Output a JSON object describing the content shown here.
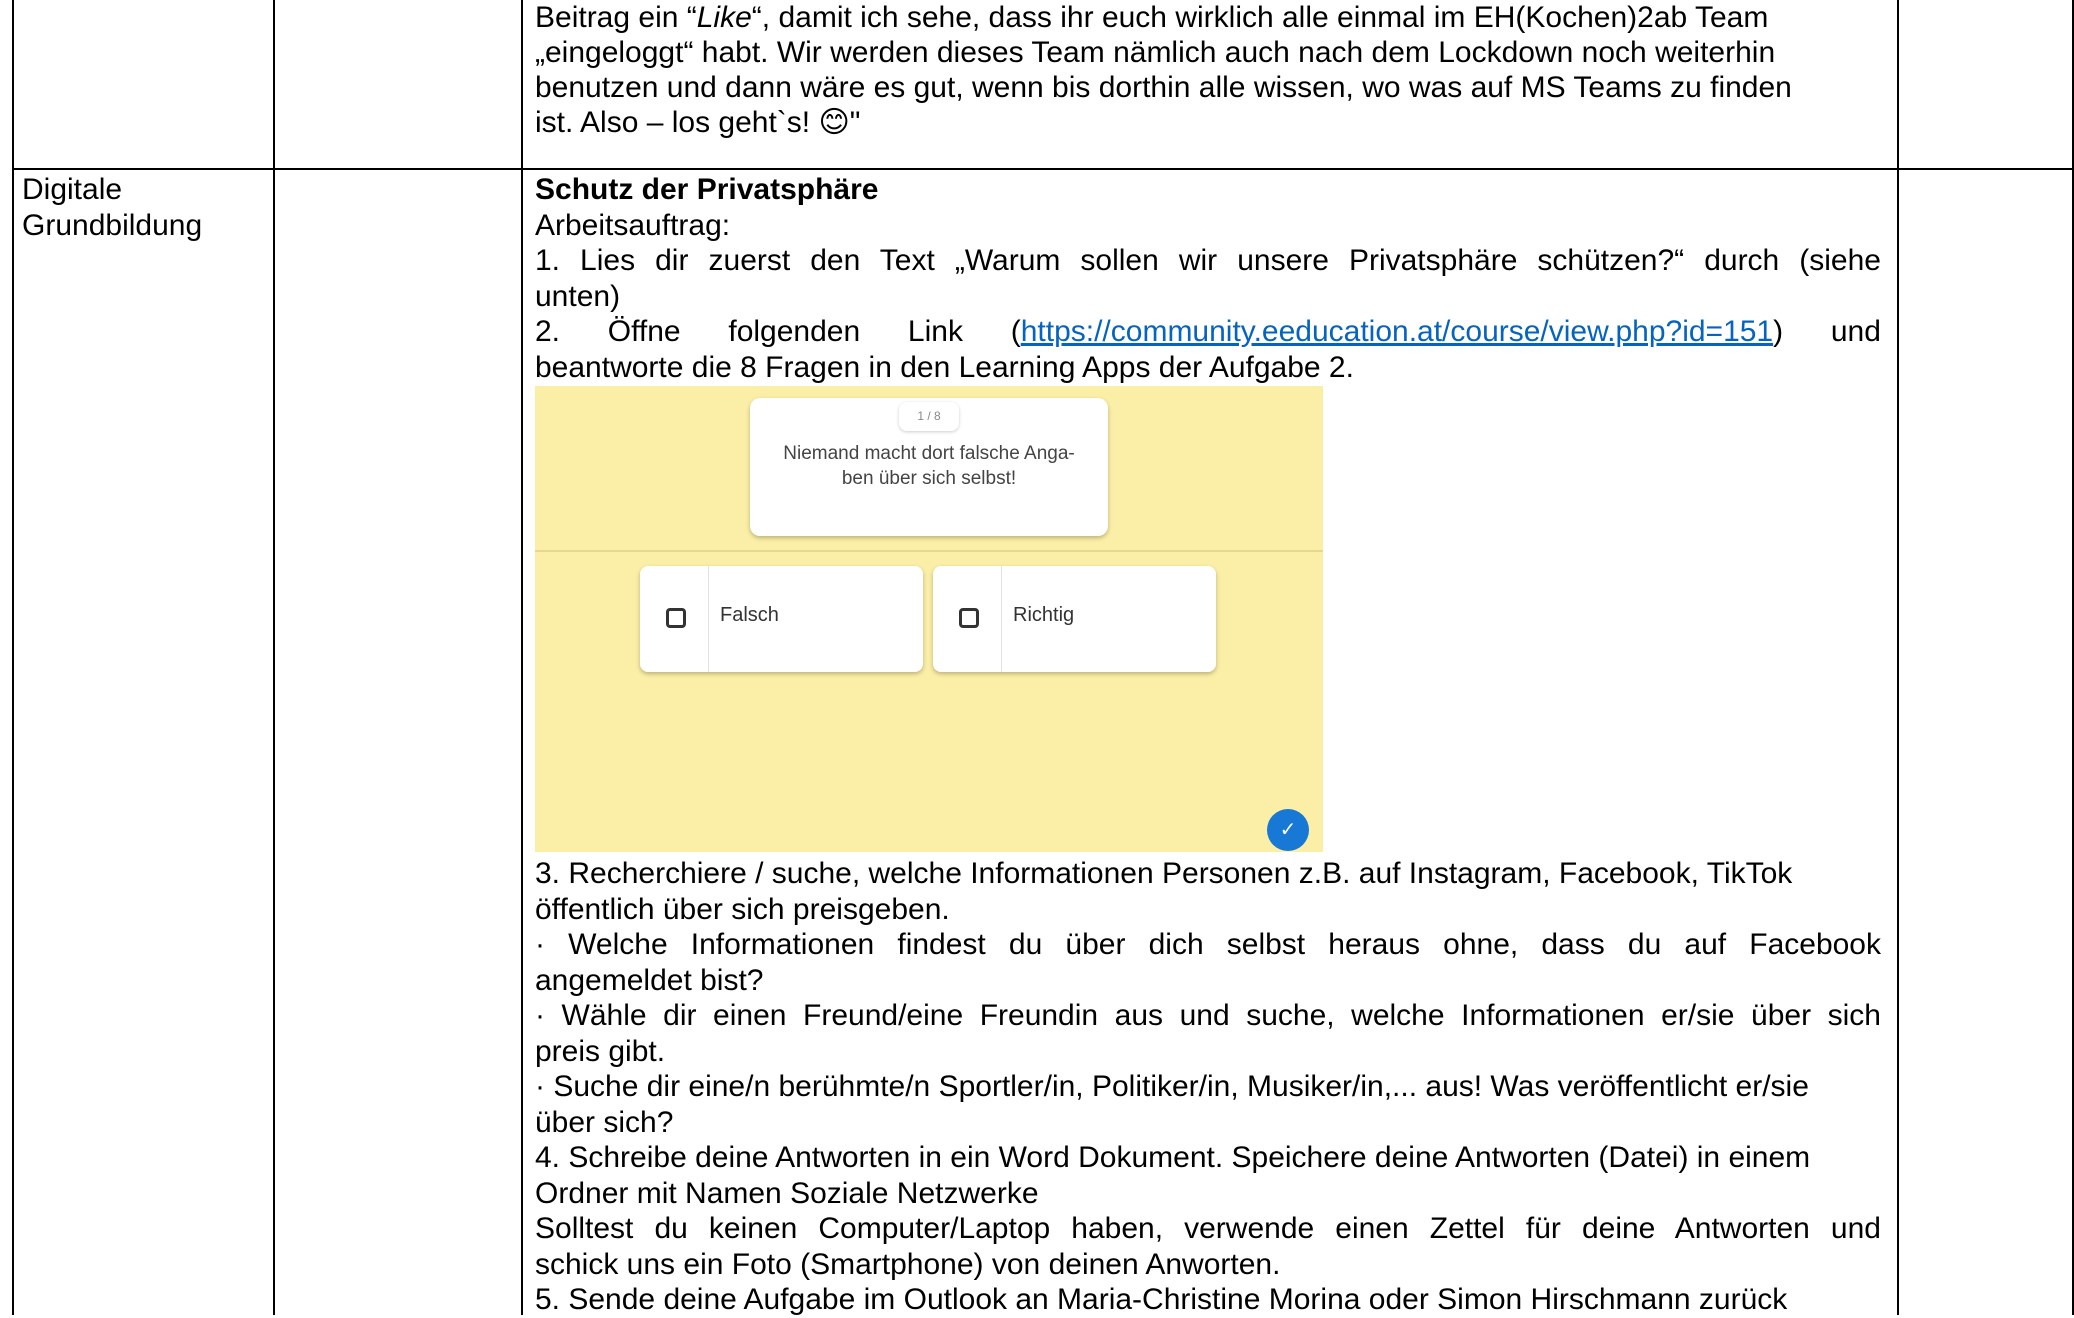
{
  "row1": {
    "lines": [
      {
        "pre": "Beitrag ein “",
        "em": "Like",
        "post": "“, damit ich sehe, dass ihr euch wirklich alle einmal im EH(Kochen)2ab Team"
      },
      "„eingeloggt“ habt. Wir werden dieses Team nämlich auch nach dem Lockdown noch weiterhin",
      "benutzen und dann wäre es gut, wenn bis dorthin alle wissen, wo was auf MS Teams zu finden",
      {
        "pre": "ist. Also – los geht`s! ",
        "emoji": "😊",
        "post": "\""
      }
    ]
  },
  "row2": {
    "subject": [
      "Digitale",
      "Grundbildung"
    ],
    "heading": "Schutz der Privatsphäre",
    "task_label": "Arbeitsauftrag:",
    "step1": [
      "1. Lies dir zuerst den Text „Warum sollen wir unsere Privatsphäre schützen?“ durch (siehe",
      "unten)"
    ],
    "step2_words": [
      "2.",
      "Öffne",
      "folgenden",
      "Link",
      "und"
    ],
    "step2_link": "https://community.eeducation.at/course/view.php?id=151",
    "step2_line2": "beantworte die 8 Fragen in den Learning Apps der Aufgabe 2.",
    "quiz": {
      "counter": "1 / 8",
      "question": "Niemand macht dort falsche Anga-ben über sich selbst!",
      "answers": [
        "Falsch",
        "Richtig"
      ],
      "check_icon": "check-icon",
      "background": "#fbeea6",
      "accent": "#1778d6"
    },
    "step3": [
      "3. Recherchiere / suche, welche Informationen Personen z.B. auf Instagram, Facebook, TikTok",
      "öffentlich über sich preisgeben."
    ],
    "bullets": [
      [
        "· Welche Informationen findest du über dich selbst heraus ohne, dass du auf Facebook",
        "angemeldet bist?"
      ],
      [
        "· Wähle dir einen Freund/eine Freundin aus und suche, welche Informationen er/sie über sich",
        "preis gibt."
      ],
      [
        "· Suche dir eine/n berühmte/n Sportler/in, Politiker/in, Musiker/in,... aus! Was veröffentlicht er/sie",
        "über sich?"
      ]
    ],
    "step4": [
      "4. Schreibe deine Antworten in ein Word Dokument. Speichere deine Antworten (Datei) in einem",
      "Ordner mit Namen Soziale Netzwerke"
    ],
    "no_computer": [
      "Solltest du keinen Computer/Laptop haben, verwende einen Zettel für deine Antworten und",
      "schick uns ein Foto (Smartphone) von deinen Anworten."
    ],
    "step5": "5. Sende deine Aufgabe im Outlook an Maria-Christine Morina oder Simon Hirschmann zurück"
  }
}
